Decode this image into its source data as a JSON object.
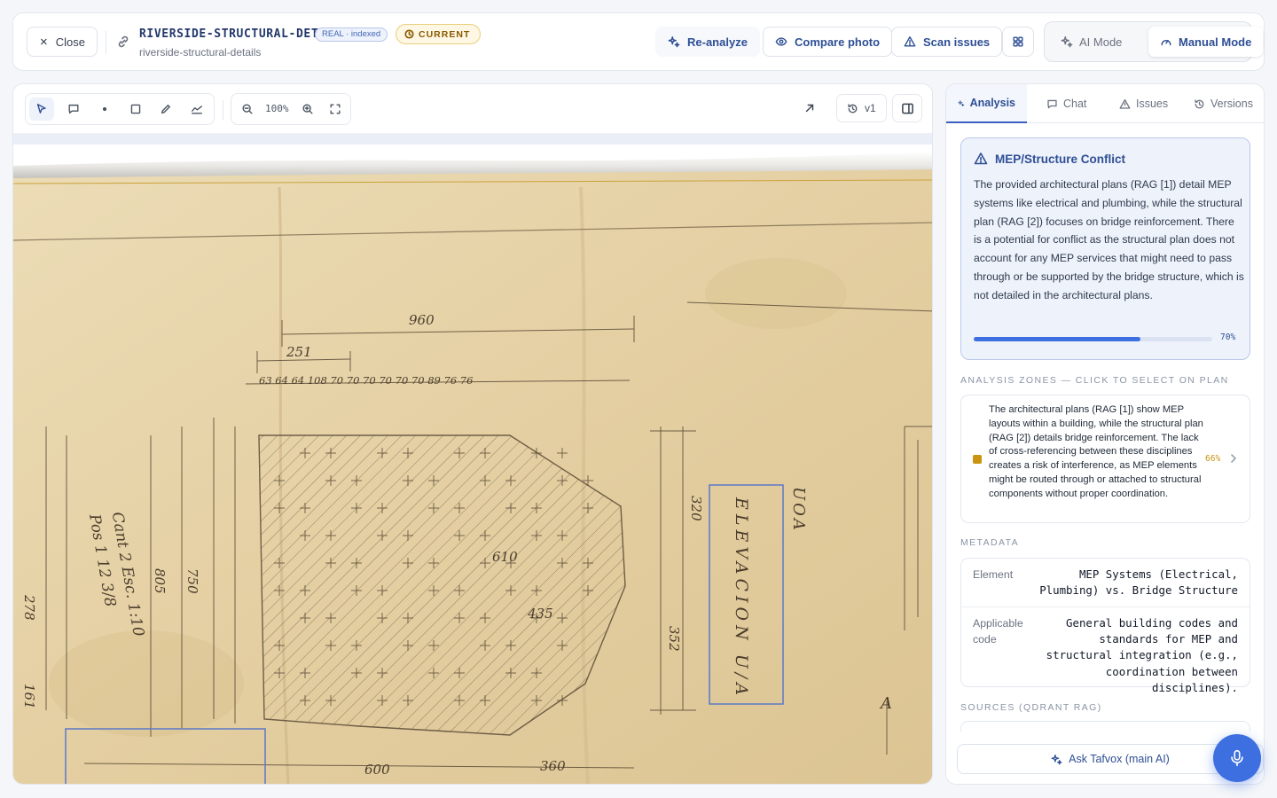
{
  "header": {
    "close_label": "Close",
    "doc_title": "RIVERSIDE-STRUCTURAL-DET",
    "doc_subtitle": "riverside-structural-details",
    "real_badge": "REAL · indexed",
    "status_badge": "CURRENT",
    "reanalyze_label": "Re-analyze",
    "compare_label": "Compare photo",
    "scan_label": "Scan issues",
    "ai_mode_label": "AI Mode",
    "manual_mode_label": "Manual Mode",
    "active_mode": "Manual Mode"
  },
  "canvas": {
    "zoom": "100%",
    "version": "v1",
    "tools": [
      "select",
      "comment",
      "point",
      "rectangle",
      "pen",
      "polyline"
    ],
    "active_tool": "select",
    "plan_labels": {
      "d960": "960",
      "d251": "251",
      "d610": "610",
      "d435": "435",
      "d600": "600",
      "d360": "360",
      "d320": "320",
      "d352": "352",
      "d805": "805",
      "d750": "750",
      "d278": "278",
      "d161": "161",
      "top_row": "63 64 64 108 70 70 70 70 70 70 89 76 76",
      "elevacion": "ELEVACION  U/A",
      "uoa": "UOA",
      "pos": "Pos 1  12 3/8",
      "cant": "Cant 2   Esc. 1:10",
      "a_mark": "A"
    },
    "selection_colors": {
      "zone": "#5b78c7"
    }
  },
  "panel": {
    "tabs": [
      {
        "label": "Analysis",
        "icon": "sparkle-icon"
      },
      {
        "label": "Chat",
        "icon": "chat-icon"
      },
      {
        "label": "Issues",
        "icon": "warning-icon"
      },
      {
        "label": "Versions",
        "icon": "history-icon"
      }
    ],
    "active_tab": "Analysis",
    "conflict": {
      "title": "MEP/Structure Conflict",
      "text": "The provided architectural plans (RAG [1]) detail MEP systems like electrical and plumbing, while the structural plan (RAG [2]) focuses on bridge reinforcement. There is a potential for conflict as the structural plan does not account for any MEP services that might need to pass through or be supported by the bridge structure, which is not detailed in the architectural plans.",
      "confidence": 0.7,
      "confidence_label": "70%"
    },
    "zones_label": "ANALYSIS ZONES — CLICK TO SELECT ON PLAN",
    "zones": [
      {
        "text": "The architectural plans (RAG [1]) show MEP layouts within a building, while the structural plan (RAG [2]) details bridge reinforcement. The lack of cross-referencing between these disciplines creates a risk of interference, as MEP elements might be routed through or attached to structural components without proper coordination.",
        "confidence_label": "66%",
        "color": "#c99410"
      }
    ],
    "metadata_label": "METADATA",
    "metadata": {
      "element_key": "Element",
      "element_val": "MEP Systems (Electrical, Plumbing) vs. Bridge Structure",
      "code_key": "Applicable code",
      "code_val": "General building codes and standards for MEP and structural integration (e.g., coordination between disciplines)."
    },
    "sources_label": "SOURCES (QDRANT RAG)",
    "ask_label": "Ask Tafvox (main AI)"
  },
  "colors": {
    "accent": "#3d6fe0",
    "accent_dark": "#2e4f95",
    "paper": "#e6d3aa",
    "ink": "#5a4a36",
    "warning": "#c99410"
  }
}
